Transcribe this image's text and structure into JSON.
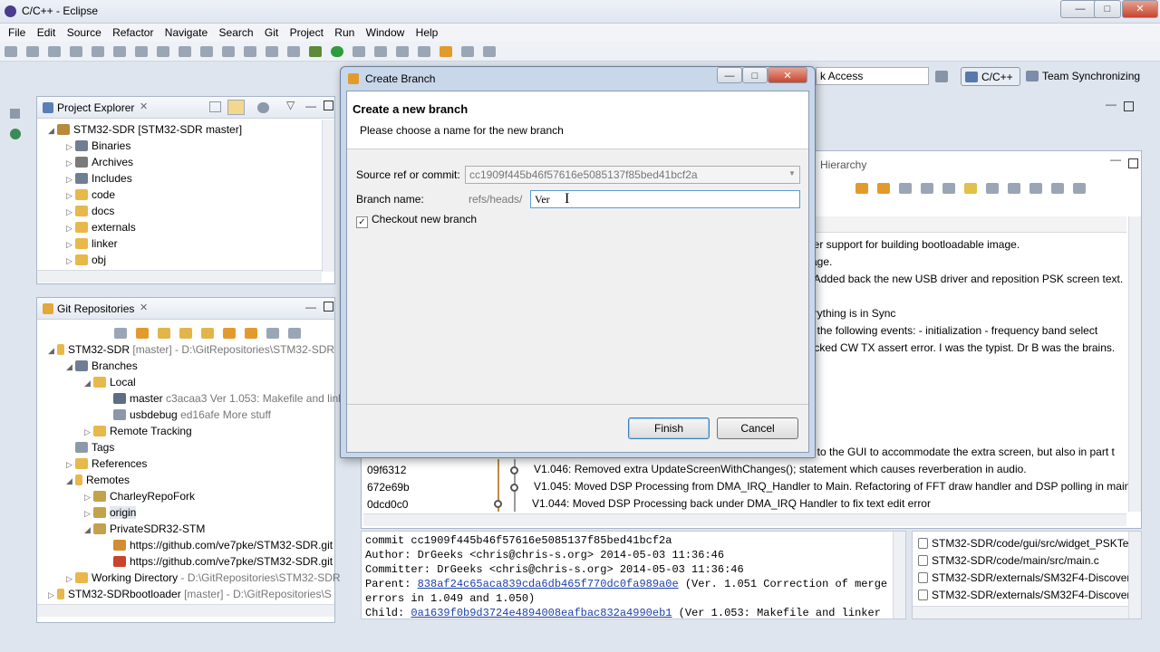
{
  "window": {
    "title": "C/C++ - Eclipse"
  },
  "menu": [
    "File",
    "Edit",
    "Source",
    "Refactor",
    "Navigate",
    "Search",
    "Git",
    "Project",
    "Run",
    "Window",
    "Help"
  ],
  "perspective": {
    "quick_access": "k Access",
    "cpp": "C/C++",
    "team": "Team Synchronizing"
  },
  "project_explorer": {
    "title": "Project Explorer",
    "root": "STM32-SDR [STM32-SDR master]",
    "items": [
      "Binaries",
      "Archives",
      "Includes",
      "code",
      "docs",
      "externals",
      "linker",
      "obj"
    ]
  },
  "git_repos": {
    "title": "Git Repositories",
    "repo": {
      "name": "STM32-SDR",
      "detail": "[master] - D:\\GitRepositories\\STM32-SDR"
    },
    "branches": "Branches",
    "local": "Local",
    "master": {
      "name": "master",
      "detail": "c3acaa3 Ver 1.053: Makefile and link"
    },
    "usbdebug": {
      "name": "usbdebug",
      "detail": "ed16afe More stuff"
    },
    "remote_tracking": "Remote Tracking",
    "tags": "Tags",
    "references": "References",
    "remotes": "Remotes",
    "charley": "CharleyRepoFork",
    "origin": "origin",
    "private": "PrivateSDR32-STM",
    "url1": "https://github.com/ve7pke/STM32-SDR.git",
    "url2": "https://github.com/ve7pke/STM32-SDR.git",
    "workdir": {
      "name": "Working Directory",
      "detail": "- D:\\GitRepositories\\STM32-SDR"
    },
    "bootloader": {
      "name": "STM32-SDRbootloader",
      "detail": "[master] - D:\\GitRepositories\\S"
    }
  },
  "history": {
    "hierarchy_tab": "Hierarchy",
    "lines": [
      "nker support for building bootloadable image.",
      "mage.",
      "e. Added back the new USB driver and reposition PSK screen text.",
      "",
      "verything is in Sync",
      "on  the following events:  - initialization  - frequency band select",
      "hacked CW TX assert error. I was the typist. Dr B was the brains.",
      "",
      "",
      "",
      "",
      "ge to the GUI to accommodate the extra screen, but also in part t"
    ],
    "commits": [
      {
        "id": "09f6312",
        "msg": "V1.046: Removed extra UpdateScreenWithChanges(); statement which causes reverberation in audio."
      },
      {
        "id": "672e69b",
        "msg": "V1.045: Moved DSP Processing from DMA_IRQ_Handler to Main.  Refactoring of FFT draw handler and DSP polling in main c"
      },
      {
        "id": "0dcd0c0",
        "msg": "V1.044: Moved DSP Processing back under DMA_IRQ Handler to fix text edit error"
      }
    ]
  },
  "commit_detail": {
    "line1": "commit cc1909f445b46f57616e5085137f85bed41bcf2a",
    "line2": "Author: DrGeeks <chris@chris-s.org> 2014-05-03 11:36:46",
    "line3": "Committer: DrGeeks <chris@chris-s.org> 2014-05-03 11:36:46",
    "parent_label": "Parent: ",
    "parent_hash": "838af24c65aca839cda6db465f770dc0fa989a0e",
    "parent_rest": " (Ver. 1.051 Correction of merge",
    "line5": "errors in 1.049 and 1.050)",
    "child_label": "Child: ",
    "child_hash": "0a1639f0b9d3724e4894008eafbac832a4990eb1",
    "child_rest": " (Ver 1.053: Makefile and linker"
  },
  "files": [
    "STM32-SDR/code/gui/src/widget_PSKTe",
    "STM32-SDR/code/main/src/main.c",
    "STM32-SDR/externals/SM32F4-Discovery",
    "STM32-SDR/externals/SM32F4-Discovery"
  ],
  "dialog": {
    "title": "Create Branch",
    "heading": "Create a new branch",
    "subheading": "Please choose a name for the new branch",
    "source_label": "Source ref or commit:",
    "source_value": "cc1909f445b46f57616e5085137f85bed41bcf2a",
    "branch_label": "Branch name:",
    "prefix": "refs/heads/",
    "branch_value": "Ver",
    "checkout_label": "Checkout new branch",
    "finish": "Finish",
    "cancel": "Cancel"
  }
}
